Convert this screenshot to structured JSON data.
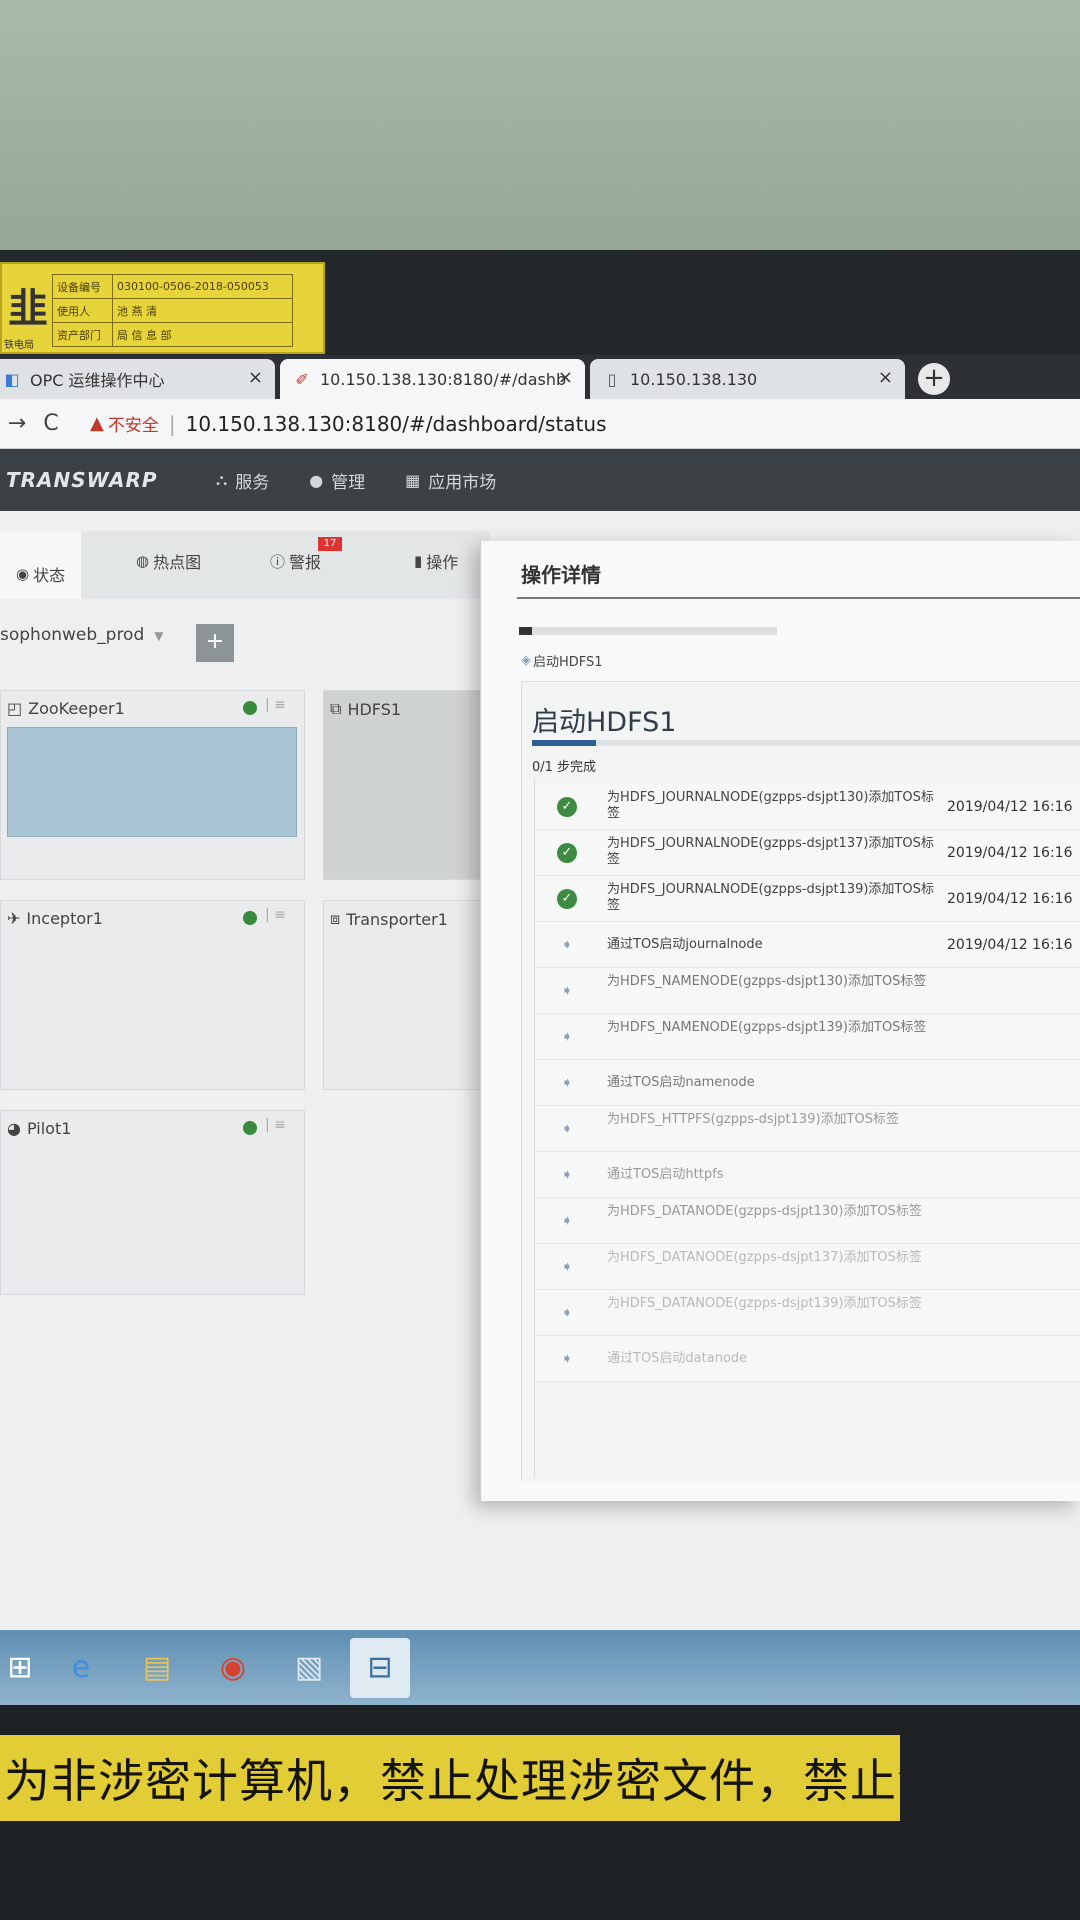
{
  "asset_tag": {
    "logo": "韭",
    "logo_sub": "铁电局",
    "rows": [
      {
        "key": "设备编号",
        "value": "030100-0506-2018-050053"
      },
      {
        "key": "使用人",
        "value": "池  燕  清"
      },
      {
        "key": "资产部门",
        "value": "局  信  息  部"
      }
    ]
  },
  "browser": {
    "tabs": [
      {
        "title": "OPC 运维操作中心",
        "close": "×"
      },
      {
        "title": "10.150.138.130:8180/#/dashb",
        "close": "×"
      },
      {
        "title": "10.150.138.130",
        "close": "×"
      }
    ],
    "new_tab": "+",
    "security_label": "不安全",
    "url": "10.150.138.130:8180/#/dashboard/status"
  },
  "app": {
    "brand": "TRANSWARP",
    "nav": [
      {
        "label": "服务",
        "icon": "services-icon"
      },
      {
        "label": "管理",
        "icon": "user-icon"
      },
      {
        "label": "应用市场",
        "icon": "grid-icon"
      }
    ],
    "dash_tabs": [
      {
        "label": "状态"
      },
      {
        "label": "热点图"
      },
      {
        "label": "警报"
      },
      {
        "label": "操作"
      }
    ],
    "alert_badge": "17",
    "cluster_selector": "sophonweb_prod",
    "add_button": "+",
    "cards": [
      {
        "name": "ZooKeeper1"
      },
      {
        "name": "HDFS1"
      },
      {
        "name": "Inceptor1"
      },
      {
        "name": "Transporter1"
      },
      {
        "name": "Pilot1"
      }
    ]
  },
  "modal": {
    "title": "操作详情",
    "progress": 0.05,
    "crumb": "启动HDFS1",
    "inner_title": "启动HDFS1",
    "step_count": "0/1 步完成",
    "steps": [
      {
        "name": "为HDFS_JOURNALNODE(gzpps-dsjpt130)添加TOS标签",
        "time": "2019/04/12 16:16",
        "status": "done"
      },
      {
        "name": "为HDFS_JOURNALNODE(gzpps-dsjpt137)添加TOS标签",
        "time": "2019/04/12 16:16",
        "status": "done"
      },
      {
        "name": "为HDFS_JOURNALNODE(gzpps-dsjpt139)添加TOS标签",
        "time": "2019/04/12 16:16",
        "status": "done"
      },
      {
        "name": "通过TOS启动journalnode",
        "time": "2019/04/12 16:16",
        "status": "pending"
      },
      {
        "name": "为HDFS_NAMENODE(gzpps-dsjpt130)添加TOS标签",
        "time": "",
        "status": "pending"
      },
      {
        "name": "为HDFS_NAMENODE(gzpps-dsjpt139)添加TOS标签",
        "time": "",
        "status": "pending"
      },
      {
        "name": "通过TOS启动namenode",
        "time": "",
        "status": "pending"
      },
      {
        "name": "为HDFS_HTTPFS(gzpps-dsjpt139)添加TOS标签",
        "time": "",
        "status": "pending"
      },
      {
        "name": "通过TOS启动httpfs",
        "time": "",
        "status": "pending"
      },
      {
        "name": "为HDFS_DATANODE(gzpps-dsjpt130)添加TOS标签",
        "time": "",
        "status": "pending"
      },
      {
        "name": "为HDFS_DATANODE(gzpps-dsjpt137)添加TOS标签",
        "time": "",
        "status": "pending"
      },
      {
        "name": "为HDFS_DATANODE(gzpps-dsjpt139)添加TOS标签",
        "time": "",
        "status": "pending"
      },
      {
        "name": "通过TOS启动datanode",
        "time": "",
        "status": "pending"
      }
    ]
  },
  "taskbar": {
    "items": [
      {
        "name": "start-icon"
      },
      {
        "name": "ie-icon"
      },
      {
        "name": "folder-icon"
      },
      {
        "name": "chrome-icon"
      },
      {
        "name": "tool-icon"
      },
      {
        "name": "network-icon"
      }
    ]
  },
  "warning_banner": "为非涉密计算机，禁止处理涉密文件，禁止泄露局敏感信息。"
}
